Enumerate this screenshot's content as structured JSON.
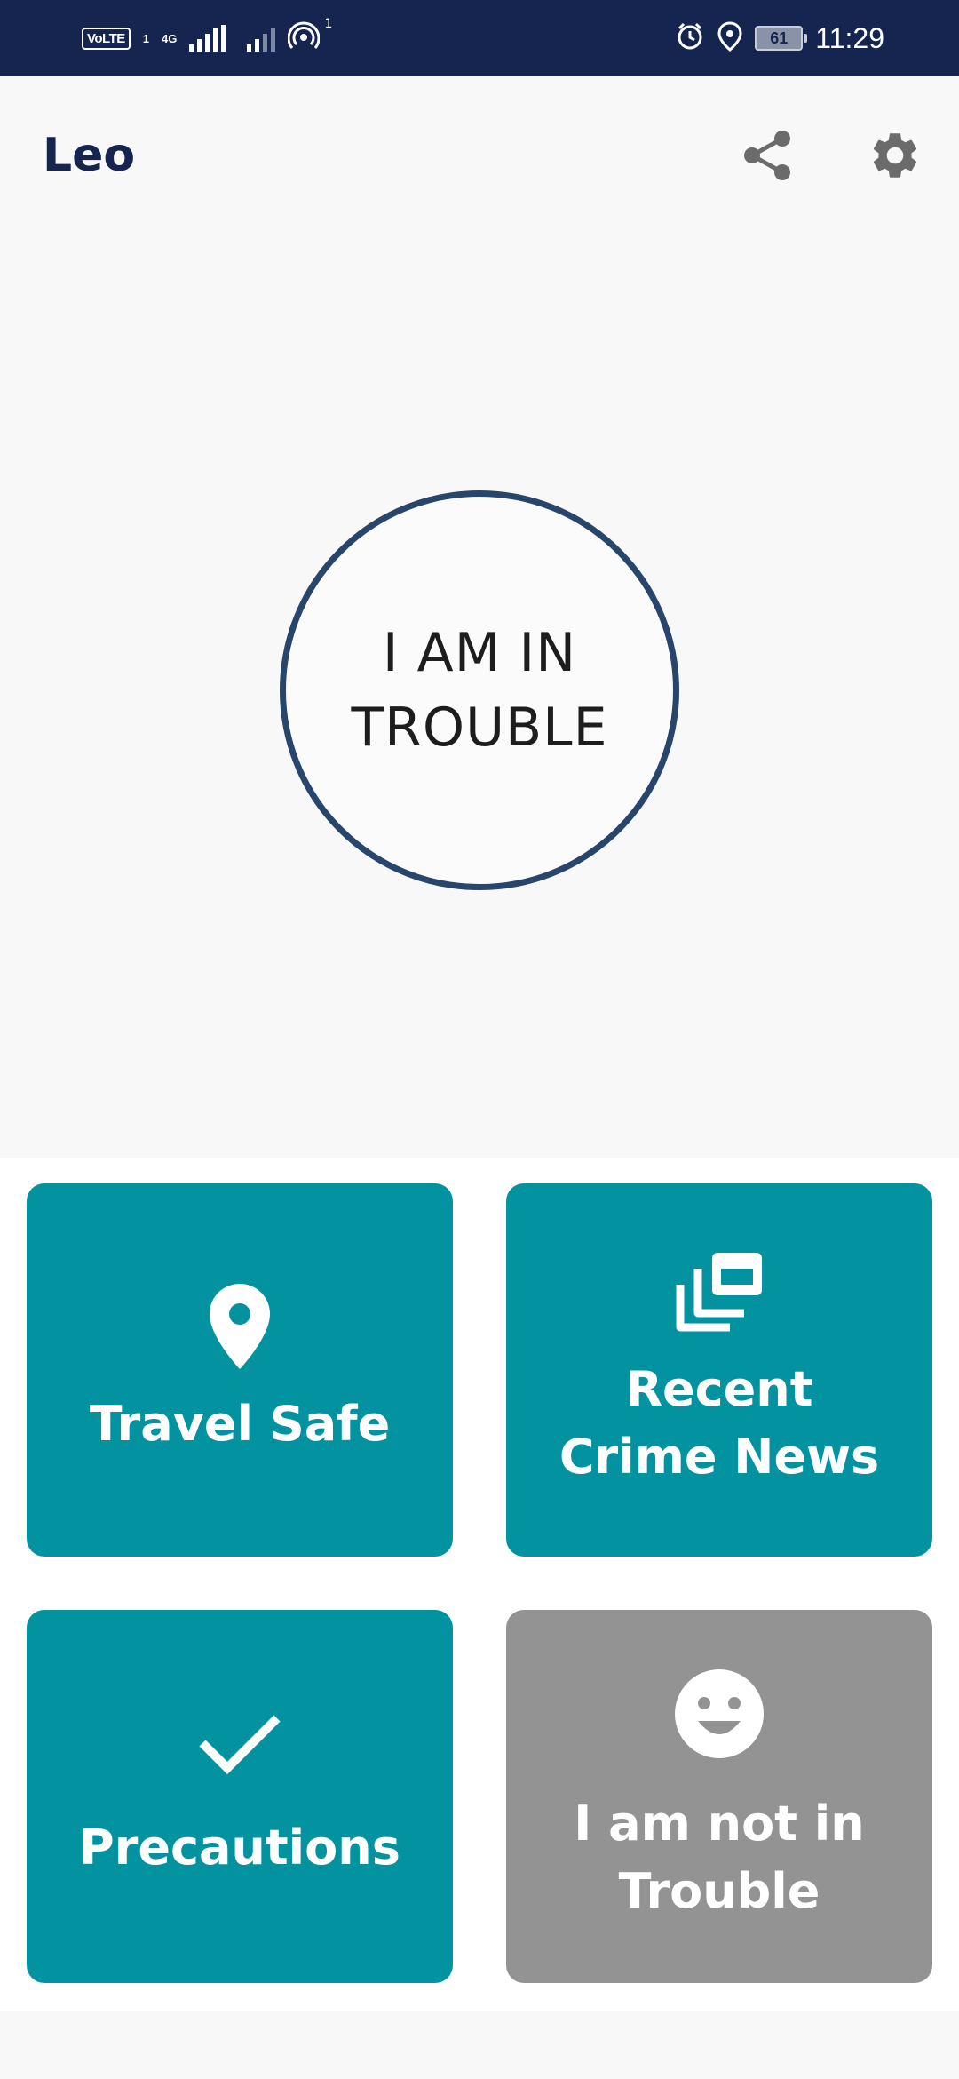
{
  "status_bar": {
    "volte": "VoLTE",
    "sim1": "1",
    "network": "4G",
    "hotspot_count": "1",
    "battery": "61",
    "time": "11:29"
  },
  "app_bar": {
    "title": "Leo",
    "share_icon": "share-icon",
    "settings_icon": "gear-icon"
  },
  "panic_button": {
    "label": "I AM IN TROUBLE",
    "border_color": "#28456b"
  },
  "tiles": [
    {
      "label": "Travel Safe",
      "icon": "location-pin-icon",
      "color": "#0292a0"
    },
    {
      "label": "Recent Crime News",
      "icon": "news-stack-icon",
      "color": "#0292a0"
    },
    {
      "label": "Precautions",
      "icon": "checkmark-icon",
      "color": "#0292a0"
    },
    {
      "label": "I am not in Trouble",
      "icon": "smiley-icon",
      "color": "#939393"
    }
  ]
}
